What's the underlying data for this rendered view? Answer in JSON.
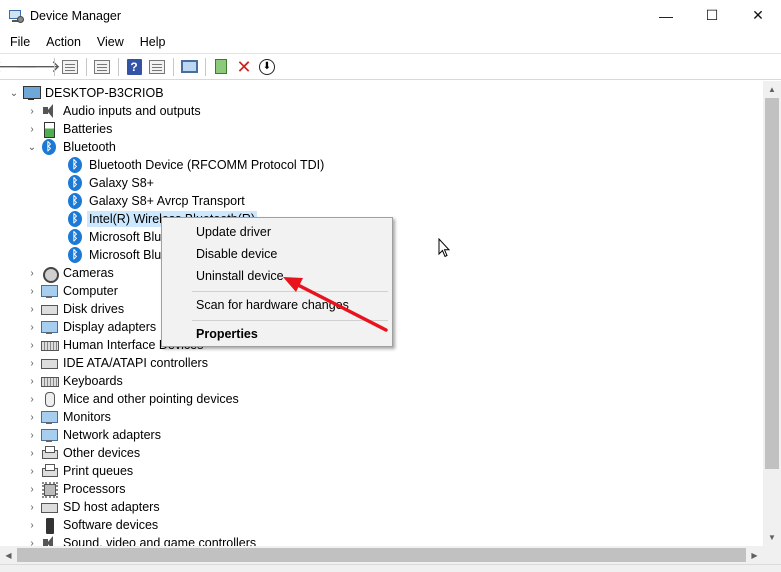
{
  "window": {
    "title": "Device Manager",
    "minimize": "—",
    "maximize": "☐",
    "close": "✕"
  },
  "menu": [
    "File",
    "Action",
    "View",
    "Help"
  ],
  "toolbar": {
    "back": "🡐",
    "forward": "🡒",
    "help": "?",
    "uninstall": "✕",
    "update": "⬇"
  },
  "tree": {
    "root": "DESKTOP-B3CRIOB",
    "nodes": [
      {
        "label": "Audio inputs and outputs",
        "icon": "speaker-icon",
        "expanded": false
      },
      {
        "label": "Batteries",
        "icon": "battery-icon",
        "expanded": false
      },
      {
        "label": "Bluetooth",
        "icon": "bluetooth-icon",
        "expanded": true
      },
      {
        "label": "Bluetooth Device (RFCOMM Protocol TDI)",
        "icon": "bluetooth-icon",
        "child": true
      },
      {
        "label": "Galaxy S8+",
        "icon": "bluetooth-icon",
        "child": true
      },
      {
        "label": "Galaxy S8+ Avrcp Transport",
        "icon": "bluetooth-icon",
        "child": true
      },
      {
        "label": "Intel(R) Wireless Bluetooth(R)",
        "icon": "bluetooth-icon",
        "child": true,
        "selected": true
      },
      {
        "label": "Microsoft Bluetooth Enumerator",
        "icon": "bluetooth-icon",
        "child": true
      },
      {
        "label": "Microsoft Bluetooth LE Enumerator",
        "icon": "bluetooth-icon",
        "child": true
      },
      {
        "label": "Cameras",
        "icon": "camera-icon",
        "expanded": false
      },
      {
        "label": "Computer",
        "icon": "monitor-icon",
        "expanded": false
      },
      {
        "label": "Disk drives",
        "icon": "disk-icon",
        "expanded": false
      },
      {
        "label": "Display adapters",
        "icon": "monitor-icon",
        "expanded": false
      },
      {
        "label": "Human Interface Devices",
        "icon": "keyboard-icon",
        "expanded": false
      },
      {
        "label": "IDE ATA/ATAPI controllers",
        "icon": "disk-icon",
        "expanded": false
      },
      {
        "label": "Keyboards",
        "icon": "keyboard-icon",
        "expanded": false
      },
      {
        "label": "Mice and other pointing devices",
        "icon": "mouse-icon",
        "expanded": false
      },
      {
        "label": "Monitors",
        "icon": "monitor-icon",
        "expanded": false
      },
      {
        "label": "Network adapters",
        "icon": "monitor-icon",
        "expanded": false
      },
      {
        "label": "Other devices",
        "icon": "printer-icon",
        "expanded": false
      },
      {
        "label": "Print queues",
        "icon": "printer-icon",
        "expanded": false
      },
      {
        "label": "Processors",
        "icon": "chip-icon",
        "expanded": false
      },
      {
        "label": "SD host adapters",
        "icon": "disk-icon",
        "expanded": false
      },
      {
        "label": "Software devices",
        "icon": "phone-icon",
        "expanded": false
      },
      {
        "label": "Sound, video and game controllers",
        "icon": "speaker-icon",
        "expanded": false
      }
    ]
  },
  "context_menu": {
    "items": [
      "Update driver",
      "Disable device",
      "Uninstall device",
      "Scan for hardware changes",
      "Properties"
    ]
  },
  "colors": {
    "selection": "#cce8ff",
    "bluetooth": "#1c7ad6",
    "annotation_arrow": "#e8141d"
  }
}
